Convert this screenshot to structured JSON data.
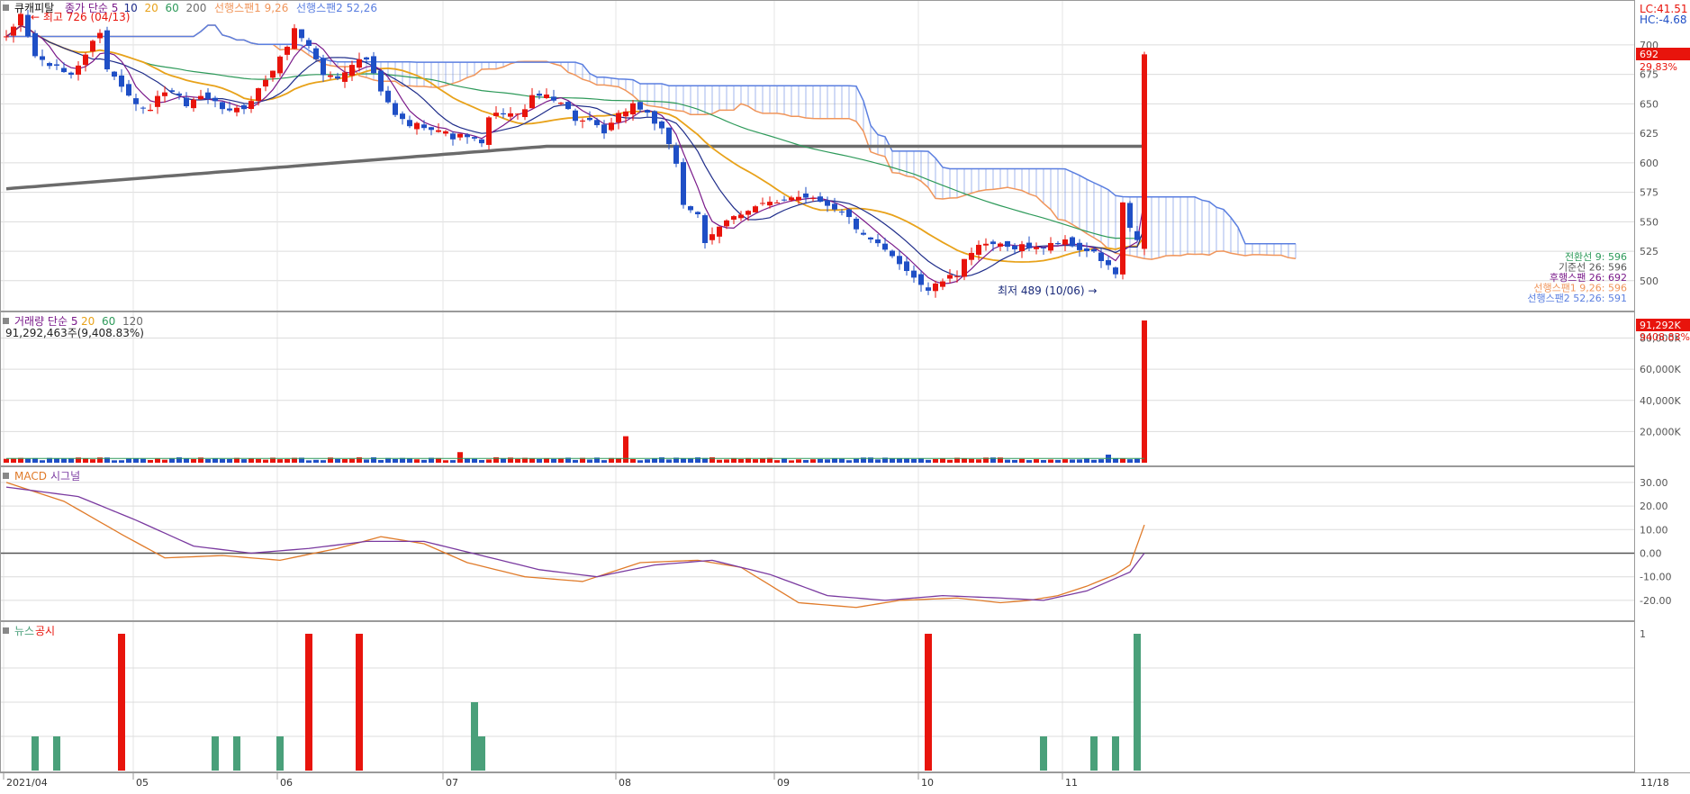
{
  "theme": {
    "candle_up": "#e8140c",
    "candle_down": "#1f4fc6",
    "cloud_span1": "#f0955a",
    "cloud_span2": "#5b7fe0",
    "ma5": "#7a1a8a",
    "ma10": "#1f2d8a",
    "ma20": "#e8a21a",
    "ma60": "#2e9a5a",
    "ma200": "#6b6b6b",
    "macd": "#e07b2a",
    "signal": "#7a3aa0",
    "news": "#4aa07a",
    "disclosure": "#e8140c",
    "grid": "#dcdcdc"
  },
  "price_panel": {
    "stock_name": "큐캐피탈",
    "legend": [
      {
        "text": "종가 단순 5",
        "color": "#7a1a8a"
      },
      {
        "text": "10",
        "color": "#1f2d8a"
      },
      {
        "text": "20",
        "color": "#e8a21a"
      },
      {
        "text": "60",
        "color": "#2e9a5a"
      },
      {
        "text": "200",
        "color": "#6b6b6b"
      },
      {
        "text": "선행스팬1 9,26",
        "color": "#f0955a"
      },
      {
        "text": "선행스팬2 52,26",
        "color": "#5b7fe0"
      }
    ],
    "top_right": [
      "LC:41.51",
      "HC:-4.68"
    ],
    "y_ticks": [
      "700",
      "675",
      "650",
      "625",
      "600",
      "575",
      "550",
      "525",
      "500"
    ],
    "high_label": "최고 726 (04/13)",
    "low_label": "최저 489 (10/06)",
    "last_price_tag": "692",
    "last_change_tag": "29.83%",
    "ichimoku_legend": [
      {
        "text": "전환선 9: 596",
        "color": "#2e9a5a"
      },
      {
        "text": "기준선 26: 596",
        "color": "#555555"
      },
      {
        "text": "후행스팬 26: 692",
        "color": "#7a1a8a"
      },
      {
        "text": "선행스팬1 9,26: 596",
        "color": "#f0955a"
      },
      {
        "text": "선행스팬2 52,26: 591",
        "color": "#5b7fe0"
      }
    ]
  },
  "volume_panel": {
    "legend": [
      {
        "text": "거래량 단순 5",
        "color": "#7a1a8a"
      },
      {
        "text": "20",
        "color": "#e8a21a"
      },
      {
        "text": "60",
        "color": "#2e9a5a"
      },
      {
        "text": "120",
        "color": "#6b6b6b"
      }
    ],
    "info": "91,292,463주(9,408.83%)",
    "y_ticks": [
      "80,000K",
      "60,000K",
      "40,000K",
      "20,000K"
    ],
    "last_tag": "91,292K",
    "last_pct": "9408.83%"
  },
  "macd_panel": {
    "legend": [
      {
        "text": "MACD",
        "color": "#e07b2a"
      },
      {
        "text": "시그널",
        "color": "#7a3aa0"
      }
    ],
    "y_ticks": [
      "30.00",
      "20.00",
      "10.00",
      "0.00",
      "-10.00",
      "-20.00"
    ]
  },
  "news_panel": {
    "legend": [
      {
        "text": "뉴스",
        "color": "#4aa07a"
      },
      {
        "text": "공시",
        "color": "#e8140c"
      }
    ],
    "y_ticks": [
      "1"
    ]
  },
  "x_axis": {
    "labels": [
      {
        "text": "2021/04",
        "idx": 0
      },
      {
        "text": "05",
        "idx": 18
      },
      {
        "text": "06",
        "idx": 38
      },
      {
        "text": "07",
        "idx": 61
      },
      {
        "text": "08",
        "idx": 85
      },
      {
        "text": "09",
        "idx": 107
      },
      {
        "text": "10",
        "idx": 127
      },
      {
        "text": "11",
        "idx": 147
      }
    ],
    "right_label": "11/18"
  },
  "chart_data": [
    {
      "type": "candlestick",
      "title": "큐캐피탈",
      "ylim": [
        480,
        732
      ],
      "categories_count": 162,
      "x_labels": [
        "2021/04",
        "05",
        "06",
        "07",
        "08",
        "09",
        "10",
        "11",
        "11/18"
      ],
      "anchors": [
        [
          0,
          705
        ],
        [
          2,
          726
        ],
        [
          4,
          690
        ],
        [
          7,
          680
        ],
        [
          9,
          675
        ],
        [
          11,
          692
        ],
        [
          13,
          712
        ],
        [
          14,
          680
        ],
        [
          16,
          665
        ],
        [
          18,
          652
        ],
        [
          20,
          645
        ],
        [
          21,
          656
        ],
        [
          23,
          662
        ],
        [
          25,
          648
        ],
        [
          27,
          655
        ],
        [
          29,
          650
        ],
        [
          31,
          643
        ],
        [
          33,
          647
        ],
        [
          35,
          662
        ],
        [
          38,
          688
        ],
        [
          40,
          713
        ],
        [
          42,
          700
        ],
        [
          44,
          675
        ],
        [
          46,
          672
        ],
        [
          48,
          685
        ],
        [
          50,
          688
        ],
        [
          52,
          660
        ],
        [
          54,
          640
        ],
        [
          56,
          632
        ],
        [
          58,
          632
        ],
        [
          60,
          628
        ],
        [
          62,
          622
        ],
        [
          64,
          623
        ],
        [
          66,
          615
        ],
        [
          67,
          638
        ],
        [
          69,
          643
        ],
        [
          71,
          640
        ],
        [
          73,
          655
        ],
        [
          75,
          658
        ],
        [
          77,
          652
        ],
        [
          79,
          637
        ],
        [
          81,
          634
        ],
        [
          83,
          625
        ],
        [
          85,
          640
        ],
        [
          87,
          650
        ],
        [
          89,
          642
        ],
        [
          91,
          627
        ],
        [
          93,
          600
        ],
        [
          94,
          565
        ],
        [
          96,
          557
        ],
        [
          97,
          530
        ],
        [
          99,
          545
        ],
        [
          101,
          556
        ],
        [
          103,
          560
        ],
        [
          105,
          565
        ],
        [
          107,
          565
        ],
        [
          109,
          572
        ],
        [
          111,
          572
        ],
        [
          113,
          568
        ],
        [
          115,
          562
        ],
        [
          117,
          553
        ],
        [
          119,
          537
        ],
        [
          121,
          530
        ],
        [
          123,
          520
        ],
        [
          125,
          510
        ],
        [
          127,
          497
        ],
        [
          128,
          492
        ],
        [
          130,
          500
        ],
        [
          132,
          505
        ],
        [
          133,
          520
        ],
        [
          135,
          528
        ],
        [
          137,
          531
        ],
        [
          139,
          528
        ],
        [
          141,
          530
        ],
        [
          143,
          527
        ],
        [
          145,
          532
        ],
        [
          147,
          533
        ],
        [
          149,
          527
        ],
        [
          151,
          523
        ],
        [
          153,
          512
        ],
        [
          154,
          505
        ],
        [
          155,
          566
        ],
        [
          156,
          543
        ],
        [
          157,
          533
        ],
        [
          158,
          692
        ]
      ],
      "series": [
        {
          "name": "종가 단순 5",
          "period": 5
        },
        {
          "name": "10",
          "period": 10
        },
        {
          "name": "20",
          "period": 20
        },
        {
          "name": "60",
          "period": 60
        },
        {
          "name": "200",
          "period": 200
        },
        {
          "name": "선행스팬1 9,26"
        },
        {
          "name": "선행스팬2 52,26"
        }
      ],
      "high": {
        "value": 726,
        "date": "04/13"
      },
      "low": {
        "value": 489,
        "date": "10/06"
      },
      "last": 692
    },
    {
      "type": "bar",
      "title": "거래량",
      "unit": "K",
      "ylim": [
        0,
        91292
      ],
      "last_value": 91292463,
      "spikes": [
        [
          86,
          17000
        ],
        [
          63,
          6800
        ],
        [
          153,
          5200
        ],
        [
          157,
          2500
        ],
        [
          158,
          91292
        ]
      ],
      "baseline_volume": 2500
    },
    {
      "type": "line",
      "title": "MACD",
      "ylim": [
        -25,
        33
      ],
      "series": [
        {
          "name": "MACD",
          "anchors": [
            [
              0,
              30
            ],
            [
              8,
              22
            ],
            [
              16,
              8
            ],
            [
              22,
              -2
            ],
            [
              30,
              -1
            ],
            [
              38,
              -3
            ],
            [
              46,
              2
            ],
            [
              52,
              7
            ],
            [
              58,
              4
            ],
            [
              64,
              -4
            ],
            [
              72,
              -10
            ],
            [
              80,
              -12
            ],
            [
              88,
              -4
            ],
            [
              96,
              -3
            ],
            [
              102,
              -6
            ],
            [
              110,
              -21
            ],
            [
              118,
              -23
            ],
            [
              124,
              -20
            ],
            [
              132,
              -19
            ],
            [
              138,
              -21
            ],
            [
              142,
              -20
            ],
            [
              146,
              -18
            ],
            [
              150,
              -14
            ],
            [
              154,
              -9
            ],
            [
              156,
              -5
            ],
            [
              158,
              12
            ]
          ]
        },
        {
          "name": "시그널",
          "anchors": [
            [
              0,
              28
            ],
            [
              10,
              24
            ],
            [
              18,
              14
            ],
            [
              26,
              3
            ],
            [
              34,
              0
            ],
            [
              42,
              2
            ],
            [
              50,
              5
            ],
            [
              58,
              5
            ],
            [
              66,
              -1
            ],
            [
              74,
              -7
            ],
            [
              82,
              -10
            ],
            [
              90,
              -5
            ],
            [
              98,
              -3
            ],
            [
              106,
              -9
            ],
            [
              114,
              -18
            ],
            [
              122,
              -20
            ],
            [
              130,
              -18
            ],
            [
              138,
              -19
            ],
            [
              144,
              -20
            ],
            [
              150,
              -16
            ],
            [
              156,
              -8
            ],
            [
              158,
              0
            ]
          ]
        }
      ]
    },
    {
      "type": "bar",
      "title": "뉴스 공시",
      "ylim": [
        0,
        1
      ],
      "series": [
        {
          "name": "뉴스",
          "points": [
            [
              4,
              0.25
            ],
            [
              7,
              0.25
            ],
            [
              29,
              0.25
            ],
            [
              32,
              0.25
            ],
            [
              38,
              0.25
            ],
            [
              65,
              0.5
            ],
            [
              66,
              0.25
            ],
            [
              144,
              0.25
            ],
            [
              151,
              0.25
            ],
            [
              154,
              0.25
            ],
            [
              157,
              1
            ]
          ]
        },
        {
          "name": "공시",
          "points": [
            [
              16,
              1
            ],
            [
              42,
              1
            ],
            [
              49,
              1
            ],
            [
              128,
              1
            ]
          ]
        }
      ]
    }
  ]
}
